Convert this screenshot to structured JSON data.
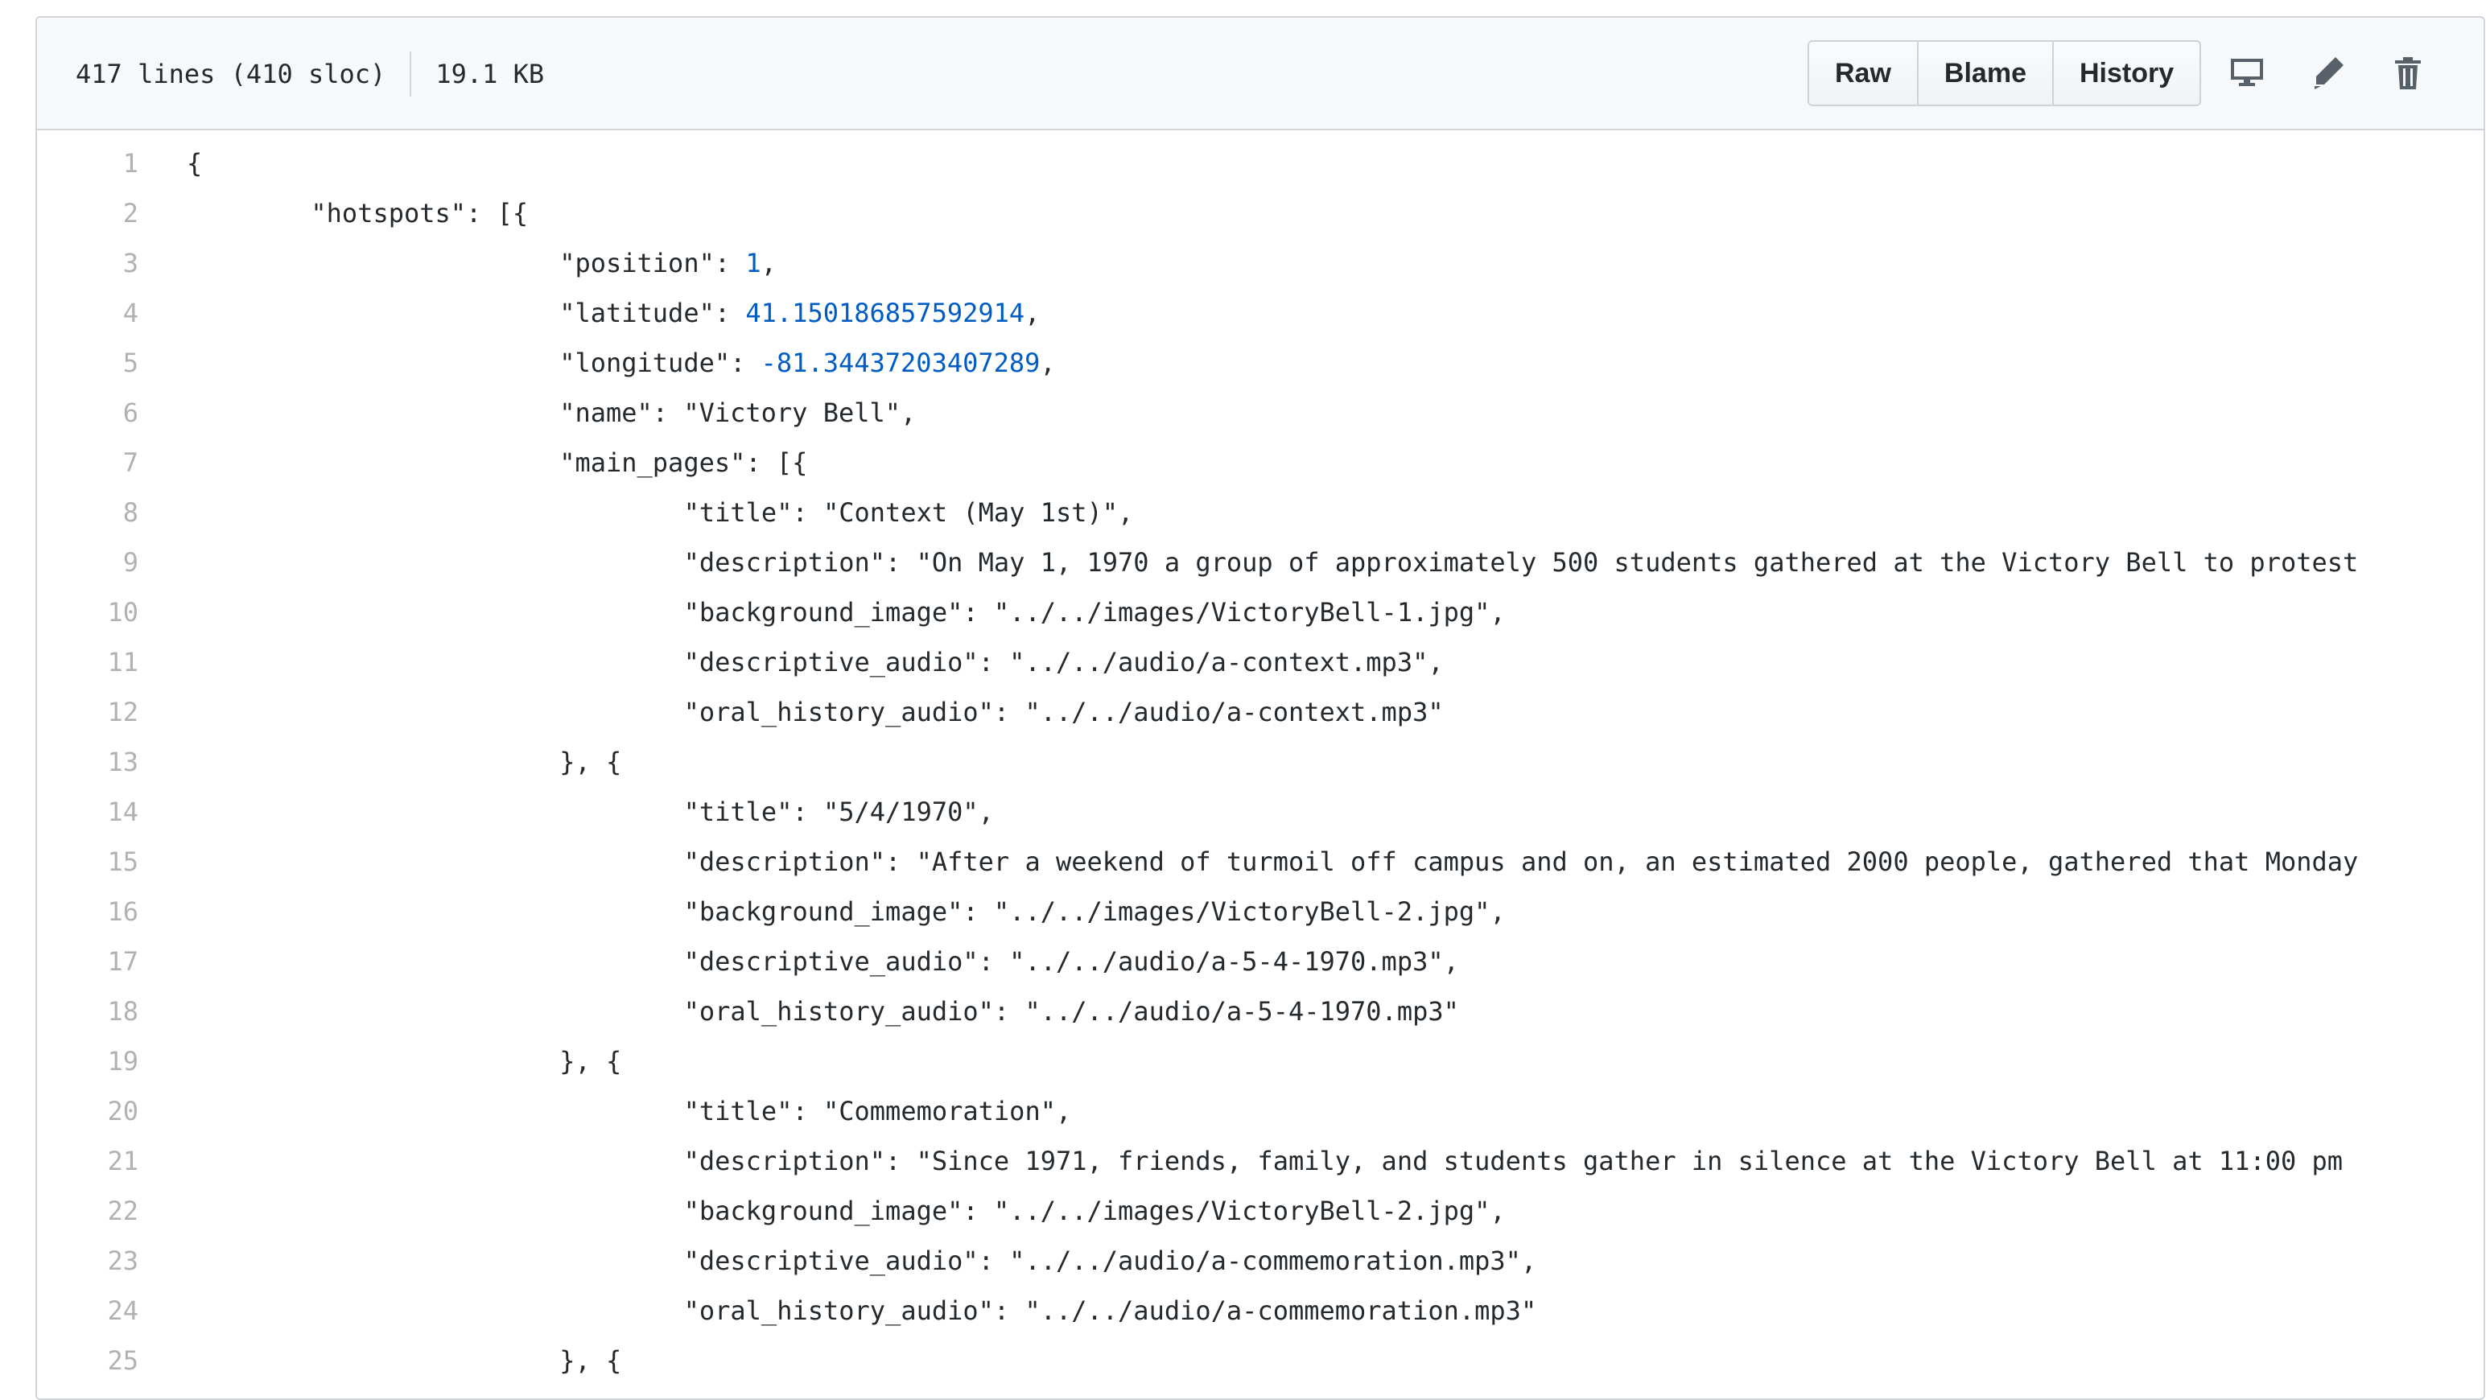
{
  "file_header": {
    "lines_info": "417 lines (410 sloc)",
    "size": "19.1 KB",
    "buttons": [
      "Raw",
      "Blame",
      "History"
    ],
    "icons": [
      "desktop-icon",
      "pencil-icon",
      "trash-icon"
    ]
  },
  "code_lines": [
    {
      "n": "1",
      "indent": 0,
      "text": "{"
    },
    {
      "n": "2",
      "indent": 1,
      "text": "\"hotspots\": [{"
    },
    {
      "n": "3",
      "indent": 3,
      "key": "\"position\": ",
      "num": "1",
      "tail": ","
    },
    {
      "n": "4",
      "indent": 3,
      "key": "\"latitude\": ",
      "num": "41.150186857592914",
      "tail": ","
    },
    {
      "n": "5",
      "indent": 3,
      "key": "\"longitude\": ",
      "num": "-81.34437203407289",
      "tail": ","
    },
    {
      "n": "6",
      "indent": 3,
      "text": "\"name\": \"Victory Bell\","
    },
    {
      "n": "7",
      "indent": 3,
      "text": "\"main_pages\": [{"
    },
    {
      "n": "8",
      "indent": 4,
      "text": "\"title\": \"Context (May 1st)\","
    },
    {
      "n": "9",
      "indent": 4,
      "text": "\"description\": \"On May 1, 1970 a group of approximately 500 students gathered at the Victory Bell to protest"
    },
    {
      "n": "10",
      "indent": 4,
      "text": "\"background_image\": \"../../images/VictoryBell-1.jpg\","
    },
    {
      "n": "11",
      "indent": 4,
      "text": "\"descriptive_audio\": \"../../audio/a-context.mp3\","
    },
    {
      "n": "12",
      "indent": 4,
      "text": "\"oral_history_audio\": \"../../audio/a-context.mp3\""
    },
    {
      "n": "13",
      "indent": 3,
      "text": "}, {"
    },
    {
      "n": "14",
      "indent": 4,
      "text": "\"title\": \"5/4/1970\","
    },
    {
      "n": "15",
      "indent": 4,
      "text": "\"description\": \"After a weekend of turmoil off campus and on, an estimated 2000 people, gathered that Monday"
    },
    {
      "n": "16",
      "indent": 4,
      "text": "\"background_image\": \"../../images/VictoryBell-2.jpg\","
    },
    {
      "n": "17",
      "indent": 4,
      "text": "\"descriptive_audio\": \"../../audio/a-5-4-1970.mp3\","
    },
    {
      "n": "18",
      "indent": 4,
      "text": "\"oral_history_audio\": \"../../audio/a-5-4-1970.mp3\""
    },
    {
      "n": "19",
      "indent": 3,
      "text": "}, {"
    },
    {
      "n": "20",
      "indent": 4,
      "text": "\"title\": \"Commemoration\","
    },
    {
      "n": "21",
      "indent": 4,
      "text": "\"description\": \"Since 1971, friends, family, and students gather in silence at the Victory Bell at 11:00 pm"
    },
    {
      "n": "22",
      "indent": 4,
      "text": "\"background_image\": \"../../images/VictoryBell-2.jpg\","
    },
    {
      "n": "23",
      "indent": 4,
      "text": "\"descriptive_audio\": \"../../audio/a-commemoration.mp3\","
    },
    {
      "n": "24",
      "indent": 4,
      "text": "\"oral_history_audio\": \"../../audio/a-commemoration.mp3\""
    },
    {
      "n": "25",
      "indent": 3,
      "text": "}, {"
    }
  ]
}
